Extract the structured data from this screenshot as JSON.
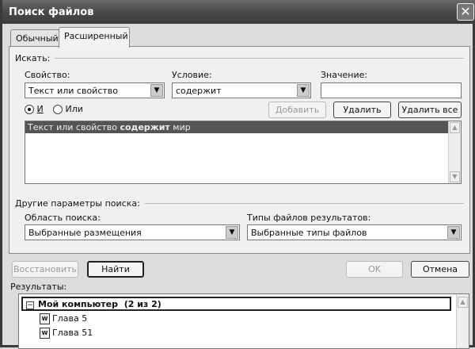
{
  "title": "Поиск файлов",
  "tabs": [
    "Обычный",
    "Расширенный"
  ],
  "search_group": "Искать:",
  "property_label": "Свойство:",
  "property_value": "Текст или свойство",
  "condition_label": "Условие:",
  "condition_value": "содержит",
  "value_label": "Значение:",
  "value_value": "",
  "and_label": "И",
  "or_label": "Или",
  "add_button": "Добавить",
  "delete_button": "Удалить",
  "delete_all_button": "Удалить все",
  "criteria": [
    {
      "prefix": "Текст или свойство ",
      "bold": "содержит",
      "suffix": " мир"
    }
  ],
  "other_group": "Другие параметры поиска:",
  "scope_label": "Область поиска:",
  "scope_value": "Выбранные размещения",
  "types_label": "Типы файлов результатов:",
  "types_value": "Выбранные типы файлов",
  "restore_button": "Восстановить",
  "find_button": "Найти",
  "ok_button": "OK",
  "cancel_button": "Отмена",
  "results_label": "Результаты:",
  "results": {
    "group": "Мой компьютер",
    "count": "(2 из 2)",
    "items": [
      "Глава 5",
      "Глава 51"
    ]
  }
}
